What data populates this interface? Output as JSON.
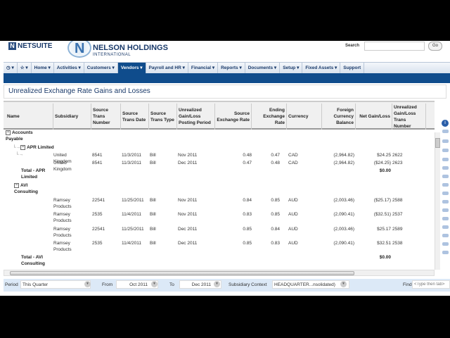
{
  "header": {
    "brand": "NETSUITE",
    "company": "NELSON HOLDINGS",
    "company_sub": "INTERNATIONAL",
    "search_label": "Search",
    "go_label": "Go"
  },
  "nav": [
    "Home ▾",
    "Activities ▾",
    "Customers ▾",
    "Vendors ▾",
    "Payroll and HR ▾",
    "Financial ▾",
    "Reports ▾",
    "Documents ▾",
    "Setup ▾",
    "Fixed Assets ▾",
    "Support"
  ],
  "title": "Unrealized Exchange Rate Gains and Losses",
  "columns": [
    "Name",
    "Subsidiary",
    "Source Trans Number",
    "Source Trans Date",
    "Source Trans Type",
    "Unrealized Gain/Loss Posting Period",
    "Source Exchange Rate",
    "Ending Exchange Rate",
    "Currency",
    "Foreign Currency Balance",
    "Net Gain/Loss",
    "Unrealized Gain/Loss Trans Number"
  ],
  "groups": {
    "ap": "Accounts Payable",
    "apr": "APR Limited",
    "apr_total": "Total - APR Limited",
    "apr_total_val": "$0.00",
    "avi": "AVI Consulting",
    "avi_total": "Total - AVI Consulting",
    "avi_total_val": "$0.00"
  },
  "rows": [
    [
      "United Kingdom",
      "8541",
      "11/3/2011",
      "Bill",
      "Nov 2011",
      "0.48",
      "0.47",
      "CAD",
      "(2,964.82)",
      "$24.25",
      "2622"
    ],
    [
      "United Kingdom",
      "8541",
      "11/3/2011",
      "Bill",
      "Dec 2011",
      "0.47",
      "0.48",
      "CAD",
      "(2,964.82)",
      "($24.25)",
      "2623"
    ],
    [
      "Ramsey Products",
      "22541",
      "11/25/2011",
      "Bill",
      "Nov 2011",
      "0.84",
      "0.85",
      "AUD",
      "(2,003.46)",
      "($25.17)",
      "2588"
    ],
    [
      "Ramsey Products",
      "2535",
      "11/4/2011",
      "Bill",
      "Nov 2011",
      "0.83",
      "0.85",
      "AUD",
      "(2,090.41)",
      "($32.51)",
      "2537"
    ],
    [
      "Ramsey Products",
      "22541",
      "11/25/2011",
      "Bill",
      "Dec 2011",
      "0.85",
      "0.84",
      "AUD",
      "(2,003.46)",
      "$25.17",
      "2589"
    ],
    [
      "Ramsey Products",
      "2535",
      "11/4/2011",
      "Bill",
      "Dec 2011",
      "0.85",
      "0.83",
      "AUD",
      "(2,090.41)",
      "$32.51",
      "2538"
    ]
  ],
  "footer": {
    "period_label": "Period",
    "period": "This Quarter",
    "from_label": "From",
    "from": "Oct 2011",
    "to_label": "To",
    "to": "Dec 2011",
    "sub_label": "Subsidiary Context",
    "sub": "HEADQUARTER...nsolidated)",
    "find_label": "Find",
    "find_placeholder": "<Type then tab>"
  }
}
